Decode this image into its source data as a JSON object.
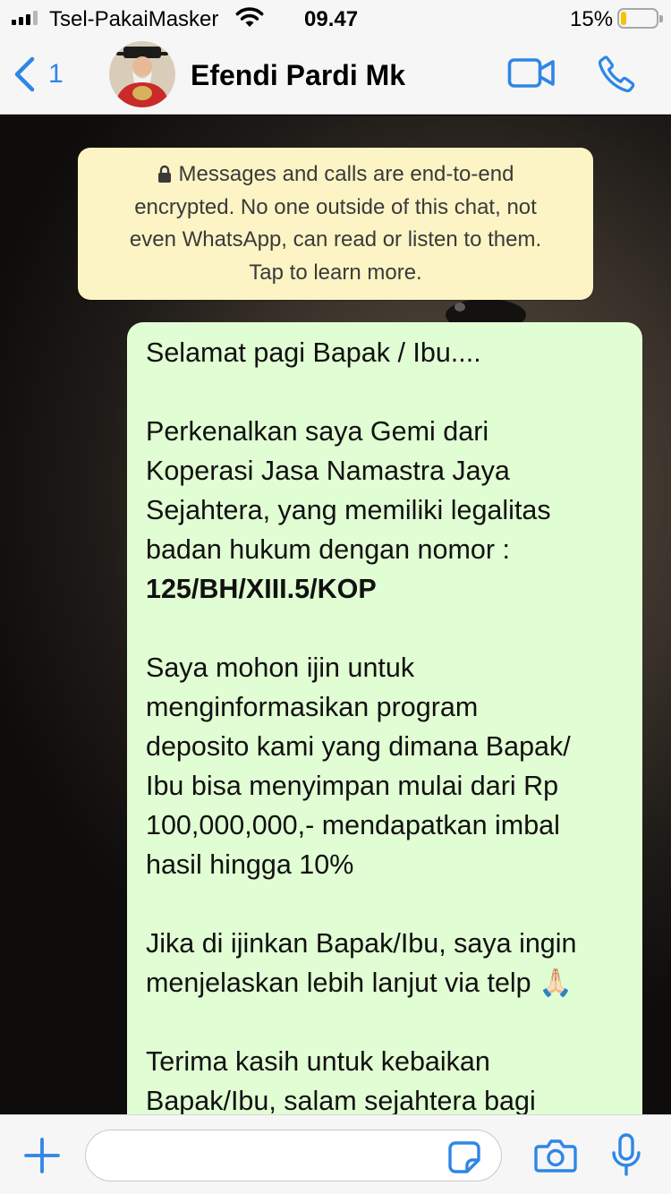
{
  "status_bar": {
    "carrier": "Tsel-PakaiMasker",
    "time": "09.47",
    "battery_percent": "15%",
    "battery_level": 0.15,
    "signal_bars": 3,
    "icons": [
      "signal-icon",
      "wifi-icon",
      "battery-icon"
    ]
  },
  "header": {
    "back_count": "1",
    "contact_name": "Efendi Pardi Mk",
    "icons": [
      "chevron-left-icon",
      "avatar",
      "video-camera-icon",
      "phone-icon"
    ]
  },
  "encryption_notice": {
    "line1": "Messages and calls are end-to-end",
    "line2": "encrypted. No one outside of this chat, not",
    "line3": "even WhatsApp, can read or listen to them.",
    "line4": "Tap to learn more."
  },
  "message": {
    "p1": "Selamat pagi Bapak / Ibu....",
    "p2_lines": [
      "Perkenalkan saya Gemi dari",
      "Koperasi Jasa Namastra Jaya",
      "Sejahtera, yang memiliki legalitas",
      "badan hukum dengan nomor :"
    ],
    "p2_bold": "125/BH/XIII.5/KOP",
    "p3_lines": [
      "Saya mohon ijin untuk",
      "menginformasikan program",
      "deposito kami yang dimana Bapak/",
      "Ibu bisa menyimpan mulai dari Rp",
      "100,000,000,- mendapatkan imbal",
      "hasil hingga 10%"
    ],
    "p4_lines": [
      "Jika di ijinkan Bapak/Ibu, saya ingin",
      "menjelaskan lebih lanjut via telp"
    ],
    "p4_emoji": "🙏🏻",
    "p5_lines": [
      "Terima kasih untuk kebaikan",
      "Bapak/Ibu, salam sejahtera bagi"
    ]
  },
  "input_bar": {
    "placeholder": "",
    "icons": [
      "plus-icon",
      "sticker-icon",
      "camera-icon",
      "microphone-icon"
    ]
  },
  "colors": {
    "accent": "#2f86e5",
    "outgoing_bubble": "#e1fdd3",
    "notice_bg": "#fcf4c4",
    "bar_bg": "#f6f6f6",
    "battery_low": "#f5c400"
  }
}
